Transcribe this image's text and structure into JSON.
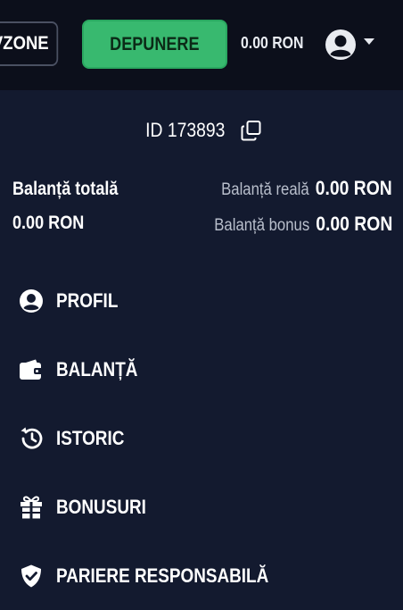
{
  "header": {
    "vzone_label": "VZONE",
    "deposit_label": "DEPUNERE",
    "balance": "0.00 RON",
    "deposit_color": "#38b96f"
  },
  "account": {
    "id_text": "ID 173893"
  },
  "balances": {
    "total_label": "Balanță totală",
    "total_value": "0.00 RON",
    "real_label": "Balanță reală",
    "real_value": "0.00 RON",
    "bonus_label": "Balanță bonus",
    "bonus_value": "0.00 RON"
  },
  "menu": {
    "items": [
      {
        "label": "PROFIL",
        "icon": "user-circle-icon"
      },
      {
        "label": "BALANȚĂ",
        "icon": "wallet-icon"
      },
      {
        "label": "ISTORIC",
        "icon": "history-icon"
      },
      {
        "label": "BONUSURI",
        "icon": "gift-icon"
      },
      {
        "label": "PARIERE RESPONSABILĂ",
        "icon": "shield-check-icon"
      }
    ]
  },
  "colors": {
    "background": "#131a2f",
    "topbar": "#0c0f1b",
    "accent": "#38b96f"
  }
}
